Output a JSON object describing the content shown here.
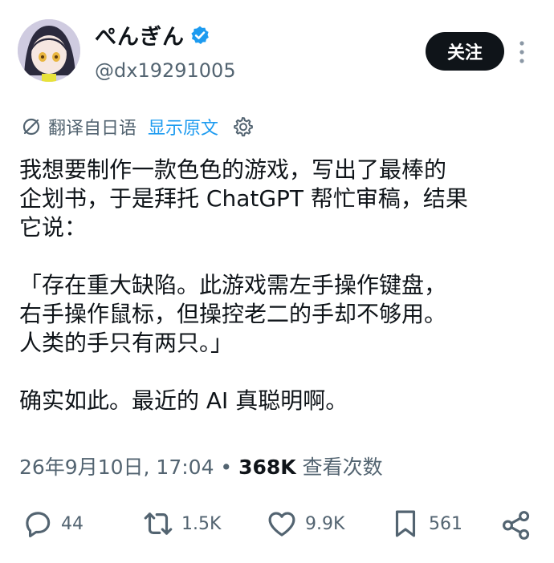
{
  "user": {
    "name": "ぺんぎん",
    "handle": "@dx19291005",
    "follow_label": "关注"
  },
  "translation": {
    "label": "翻译自日语",
    "link": "显示原文"
  },
  "post": {
    "lines": [
      "我想要制作一款色色的游戏，写出了最棒的",
      "企划书，于是拜托 ChatGPT 帮忙审稿，结果",
      "它说：",
      "",
      "「存在重大缺陷。此游戏需左手操作键盘，",
      "右手操作鼠标，但操控老二的手却不够用。",
      "人类的手只有两只。」",
      "",
      "确实如此。最近的 AI 真聪明啊。"
    ]
  },
  "meta": {
    "timestamp": "26年9月10日, 17:04",
    "separator": "•",
    "views_count": "368K",
    "views_label": "查看次数"
  },
  "actions": {
    "replies": "44",
    "reposts": "1.5K",
    "likes": "9.9K",
    "bookmarks": "561"
  },
  "icons": {
    "verified": "verified-badge-icon",
    "more": "more-vertical-icon",
    "translate": "translate-icon",
    "settings": "gear-icon",
    "reply": "reply-icon",
    "repost": "repost-icon",
    "like": "heart-icon",
    "bookmark": "bookmark-icon",
    "share": "share-icon"
  },
  "colors": {
    "accent": "#1d9bf0",
    "text": "#0f1419",
    "secondary": "#536471"
  }
}
